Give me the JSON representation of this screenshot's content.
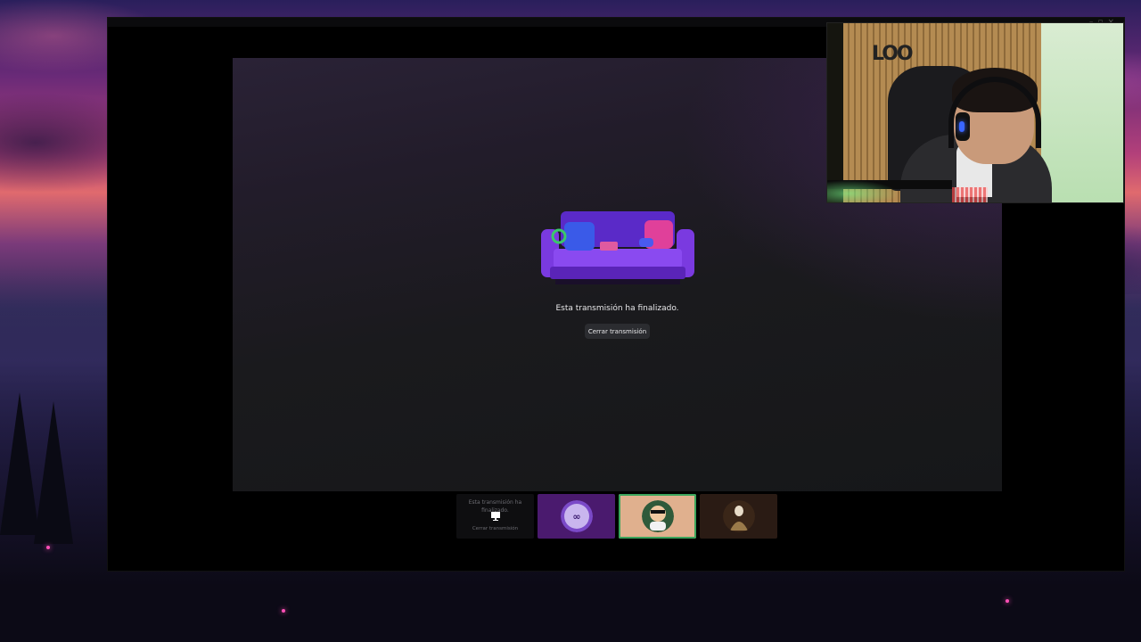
{
  "stream": {
    "ended_message": "Esta transmisión ha finalizado.",
    "close_button_label": "Cerrar transmisión"
  },
  "thumbnails": [
    {
      "type": "ended-stream",
      "message": "Esta transmisión ha finalizado.",
      "button_label": "Cerrar transmisión"
    },
    {
      "type": "avatar",
      "icon": "brand-logo-avatar"
    },
    {
      "type": "avatar",
      "icon": "character-avatar",
      "selected": true
    },
    {
      "type": "avatar",
      "icon": "figure-avatar"
    }
  ],
  "webcam": {
    "wall_logo": "LOO"
  },
  "colors": {
    "stage_bg": "#1a1a1d",
    "button_bg": "#2b2c30",
    "selected_border": "#3ba55c",
    "couch_purple": "#6a2fd6",
    "accent_pink": "#ff4fb6"
  }
}
